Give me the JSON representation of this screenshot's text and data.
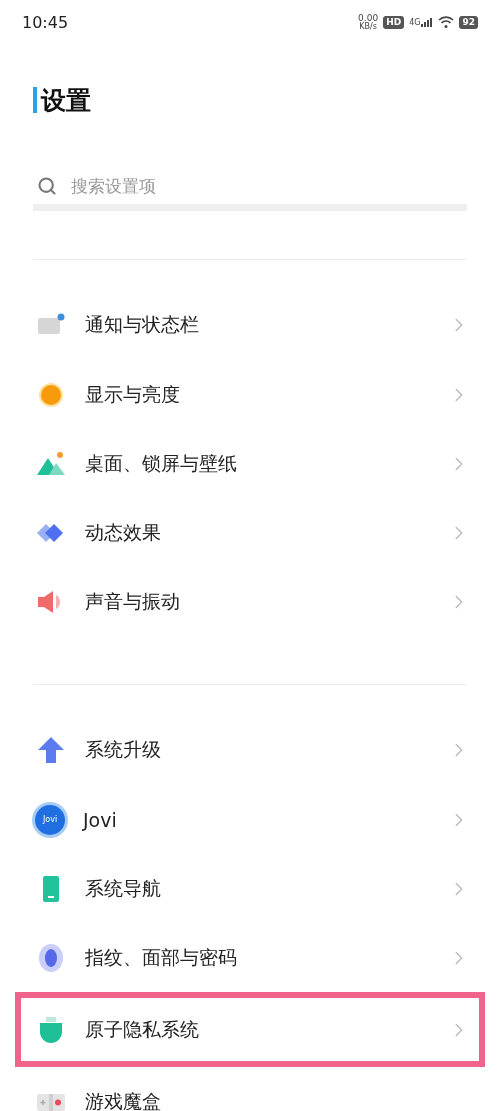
{
  "status_bar": {
    "time": "10:45",
    "speed": "0.00",
    "speed_unit": "KB/s",
    "hd": "HD",
    "network": "4G",
    "battery": "92"
  },
  "title": "设置",
  "search": {
    "placeholder": "搜索设置项"
  },
  "groups": [
    {
      "items": [
        {
          "kind": "notification",
          "label": "通知与状态栏",
          "highlighted": false,
          "chevron": true
        },
        {
          "kind": "display",
          "label": "显示与亮度",
          "highlighted": false,
          "chevron": true
        },
        {
          "kind": "wallpaper",
          "label": "桌面、锁屏与壁纸",
          "highlighted": false,
          "chevron": true
        },
        {
          "kind": "effects",
          "label": "动态效果",
          "highlighted": false,
          "chevron": true
        },
        {
          "kind": "sound",
          "label": "声音与振动",
          "highlighted": false,
          "chevron": true
        }
      ]
    },
    {
      "items": [
        {
          "kind": "upgrade",
          "label": "系统升级",
          "highlighted": false,
          "chevron": true
        },
        {
          "kind": "jovi",
          "label": "Jovi",
          "badge": "Jovi",
          "highlighted": false,
          "chevron": true
        },
        {
          "kind": "navigation",
          "label": "系统导航",
          "highlighted": false,
          "chevron": true
        },
        {
          "kind": "fingerprint",
          "label": "指纹、面部与密码",
          "highlighted": false,
          "chevron": true
        },
        {
          "kind": "privacy",
          "label": "原子隐私系统",
          "highlighted": true,
          "chevron": true
        },
        {
          "kind": "game",
          "label": "游戏魔盒",
          "highlighted": false,
          "chevron": false
        }
      ]
    }
  ]
}
